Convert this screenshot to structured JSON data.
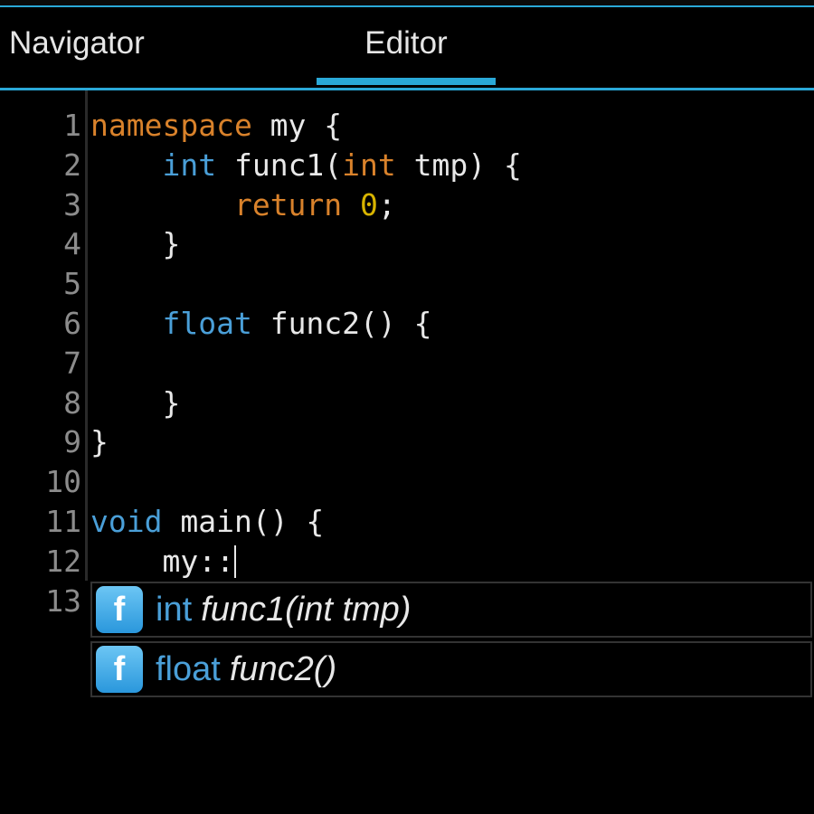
{
  "tabs": {
    "navigator": "Navigator",
    "editor": "Editor",
    "active": "Editor"
  },
  "colors": {
    "accent": "#2aa9d8",
    "keyword_control": "#d9822b",
    "keyword_type": "#4a9fd8",
    "number": "#d8b400",
    "text": "#e8e8e8",
    "line_number": "#8c8c8c",
    "background": "#000000"
  },
  "editor": {
    "line_numbers": [
      "1",
      "2",
      "3",
      "4",
      "5",
      "6",
      "7",
      "8",
      "9",
      "10",
      "11",
      "12",
      "13"
    ],
    "lines": [
      {
        "tokens": [
          {
            "t": "namespace",
            "c": "kw-orange"
          },
          {
            "t": " my {",
            "c": ""
          }
        ]
      },
      {
        "tokens": [
          {
            "t": "    ",
            "c": ""
          },
          {
            "t": "int",
            "c": "kw-blue"
          },
          {
            "t": " func1(",
            "c": ""
          },
          {
            "t": "int",
            "c": "kw-orange"
          },
          {
            "t": " tmp) {",
            "c": ""
          }
        ]
      },
      {
        "tokens": [
          {
            "t": "        ",
            "c": ""
          },
          {
            "t": "return",
            "c": "kw-orange"
          },
          {
            "t": " ",
            "c": ""
          },
          {
            "t": "0",
            "c": "num-yellow"
          },
          {
            "t": ";",
            "c": ""
          }
        ]
      },
      {
        "tokens": [
          {
            "t": "    }",
            "c": ""
          }
        ]
      },
      {
        "tokens": []
      },
      {
        "tokens": [
          {
            "t": "    ",
            "c": ""
          },
          {
            "t": "float",
            "c": "kw-blue"
          },
          {
            "t": " func2() {",
            "c": ""
          }
        ]
      },
      {
        "tokens": []
      },
      {
        "tokens": [
          {
            "t": "    }",
            "c": ""
          }
        ]
      },
      {
        "tokens": [
          {
            "t": "}",
            "c": ""
          }
        ]
      },
      {
        "tokens": []
      },
      {
        "tokens": [
          {
            "t": "void",
            "c": "kw-blue"
          },
          {
            "t": " main() {",
            "c": ""
          }
        ]
      },
      {
        "tokens": [
          {
            "t": "    my::",
            "c": ""
          }
        ]
      },
      {
        "tokens": []
      }
    ],
    "cursor_line": 12
  },
  "autocomplete": {
    "items": [
      {
        "icon": "f",
        "icon_name": "function-icon",
        "type": "int",
        "signature": "func1(int tmp)"
      },
      {
        "icon": "f",
        "icon_name": "function-icon",
        "type": "float",
        "signature": "func2()"
      }
    ]
  }
}
